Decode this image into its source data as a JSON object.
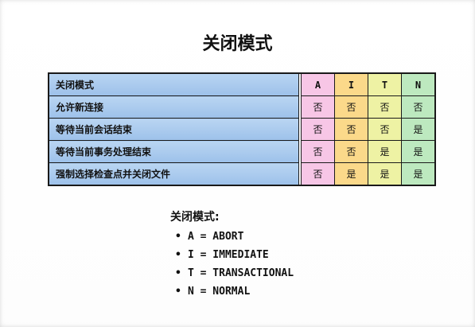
{
  "title": "关闭模式",
  "table": {
    "header": {
      "label": "关闭模式",
      "cols": [
        "A",
        "I",
        "T",
        "N"
      ]
    },
    "col_colors": [
      "#f7c6e6",
      "#fbd98a",
      "#eef2a4",
      "#bde9bf"
    ],
    "rows": [
      {
        "label": "允许新连接",
        "values": [
          "否",
          "否",
          "否",
          "否"
        ]
      },
      {
        "label": "等待当前会话结束",
        "values": [
          "否",
          "否",
          "否",
          "是"
        ]
      },
      {
        "label": "等待当前事务处理结束",
        "values": [
          "否",
          "否",
          "是",
          "是"
        ]
      },
      {
        "label": "强制选择检查点并关闭文件",
        "values": [
          "否",
          "是",
          "是",
          "是"
        ]
      }
    ]
  },
  "legend": {
    "heading": "关闭模式:",
    "items": [
      "A = ABORT",
      "I = IMMEDIATE",
      "T = TRANSACTIONAL",
      "N = NORMAL"
    ],
    "bullet": "•"
  }
}
